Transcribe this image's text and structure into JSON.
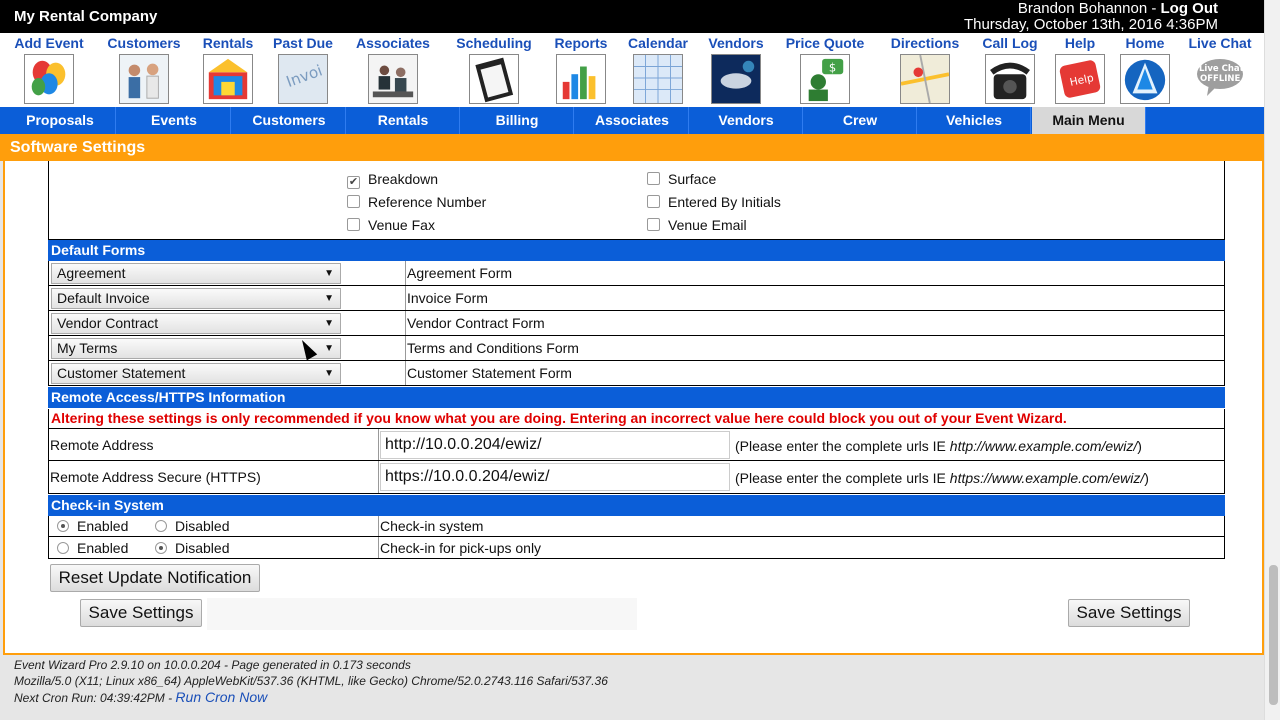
{
  "header": {
    "company": "My Rental Company",
    "user": "Brandon Bohannon",
    "separator": " - ",
    "logout": "Log Out",
    "datetime": "Thursday, October 13th, 2016 4:36PM"
  },
  "icon_nav": [
    {
      "label": "Add Event",
      "icon": "balloons-icon"
    },
    {
      "label": "Customers",
      "icon": "people-icon"
    },
    {
      "label": "Rentals",
      "icon": "bounce-house-icon"
    },
    {
      "label": "Past Due",
      "icon": "invoice-icon"
    },
    {
      "label": "Associates",
      "icon": "team-icon"
    },
    {
      "label": "Scheduling",
      "icon": "clipboard-icon"
    },
    {
      "label": "Reports",
      "icon": "chart-icon"
    },
    {
      "label": "Calendar",
      "icon": "calendar-icon"
    },
    {
      "label": "Vendors",
      "icon": "handshake-icon"
    },
    {
      "label": "Price Quote",
      "icon": "quote-icon"
    },
    {
      "label": "Directions",
      "icon": "map-icon"
    },
    {
      "label": "Call Log",
      "icon": "phone-icon"
    },
    {
      "label": "Help",
      "icon": "help-icon"
    },
    {
      "label": "Home",
      "icon": "home-icon"
    },
    {
      "label": "Live Chat",
      "icon": "live-chat-icon",
      "badge": "Live Chat OFFLINE"
    }
  ],
  "tabs": [
    "Proposals",
    "Events",
    "Customers",
    "Rentals",
    "Billing",
    "Associates",
    "Vendors",
    "Crew",
    "Vehicles",
    "Main Menu"
  ],
  "active_tab": "Main Menu",
  "page_title": "Software Settings",
  "fields_checkboxes": [
    {
      "label": "Breakdown",
      "checked": true
    },
    {
      "label": "Surface",
      "checked": false
    },
    {
      "label": "Reference Number",
      "checked": false
    },
    {
      "label": "Entered By Initials",
      "checked": false
    },
    {
      "label": "Venue Fax",
      "checked": false
    },
    {
      "label": "Venue Email",
      "checked": false
    }
  ],
  "default_forms": {
    "title": "Default Forms",
    "rows": [
      {
        "value": "Agreement",
        "label": "Agreement Form"
      },
      {
        "value": "Default Invoice",
        "label": "Invoice Form"
      },
      {
        "value": "Vendor Contract",
        "label": "Vendor Contract Form"
      },
      {
        "value": "My Terms",
        "label": "Terms and Conditions Form"
      },
      {
        "value": "Customer Statement",
        "label": "Customer Statement Form"
      }
    ]
  },
  "remote": {
    "title": "Remote Access/HTTPS Information",
    "warning": "Altering these settings is only recommended if you know what you are doing. Entering an incorrect value here could block you out of your Event Wizard.",
    "address_label": "Remote Address",
    "address_value": "http://10.0.0.204/ewiz/",
    "address_hint": "(Please enter the complete urls IE ",
    "address_example": "http://www.example.com/ewiz/",
    "secure_label": "Remote Address Secure (HTTPS)",
    "secure_value": "https://10.0.0.204/ewiz/",
    "secure_hint": "(Please enter the complete urls IE ",
    "secure_example": "https://www.example.com/ewiz/",
    "close_paren": ")"
  },
  "checkin": {
    "title": "Check-in System",
    "enabled": "Enabled",
    "disabled": "Disabled",
    "rows": [
      {
        "label": "Check-in system",
        "selected": "enabled"
      },
      {
        "label": "Check-in for pick-ups only",
        "selected": "disabled"
      }
    ]
  },
  "buttons": {
    "reset": "Reset Update Notification",
    "save": "Save Settings"
  },
  "footer": {
    "line1": "Event Wizard Pro 2.9.10 on 10.0.0.204 - Page generated in 0.173 seconds",
    "line2": "Mozilla/5.0 (X11; Linux x86_64) AppleWebKit/537.36 (KHTML, like Gecko) Chrome/52.0.2743.116 Safari/537.36",
    "line3": "Next Cron Run: 04:39:42PM - ",
    "cron_link": "Run Cron Now"
  },
  "colors": {
    "topbar": "#000000",
    "nav_link": "#1a4fb8",
    "tab_bar": "#0b5ed8",
    "orange": "#ff9e0c",
    "warning": "#e00000"
  }
}
